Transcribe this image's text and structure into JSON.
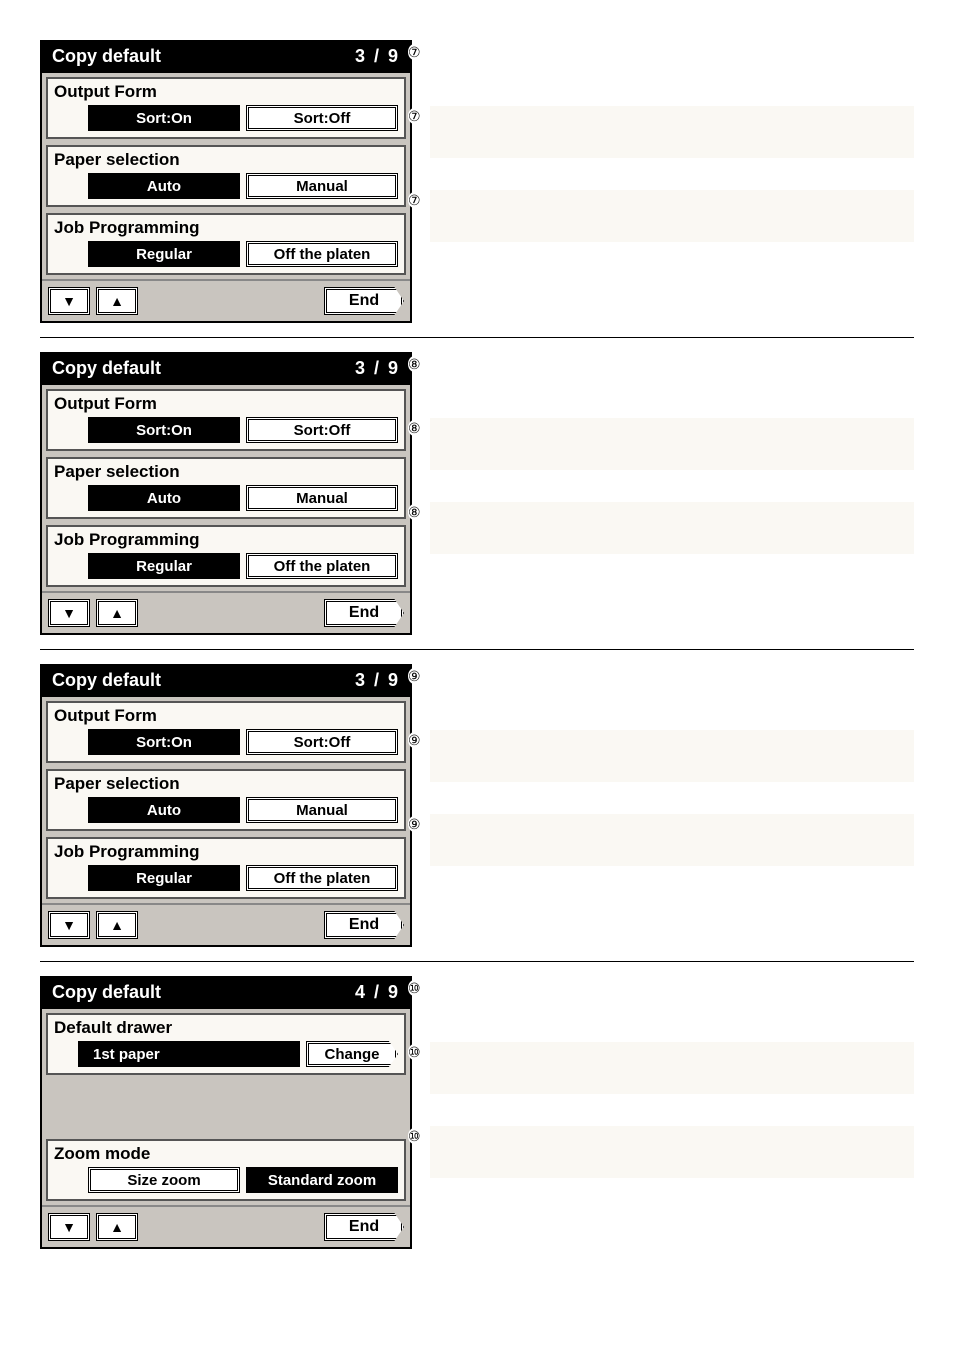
{
  "panels": [
    {
      "title": "Copy default",
      "page": "3 / 9",
      "sections": [
        {
          "label": "Output Form",
          "buttons": [
            {
              "text": "Sort:On",
              "selected": true
            },
            {
              "text": "Sort:Off",
              "selected": false
            }
          ]
        },
        {
          "label": "Paper selection",
          "buttons": [
            {
              "text": "Auto",
              "selected": true
            },
            {
              "text": "Manual",
              "selected": false
            }
          ]
        },
        {
          "label": "Job Programming",
          "buttons": [
            {
              "text": "Regular",
              "selected": true
            },
            {
              "text": "Off the platen",
              "selected": false
            }
          ]
        }
      ],
      "end": "End",
      "numbers": [
        "⑦",
        "⑦",
        "⑦"
      ]
    },
    {
      "title": "Copy default",
      "page": "3 / 9",
      "sections": [
        {
          "label": "Output Form",
          "buttons": [
            {
              "text": "Sort:On",
              "selected": true
            },
            {
              "text": "Sort:Off",
              "selected": false
            }
          ]
        },
        {
          "label": "Paper selection",
          "buttons": [
            {
              "text": "Auto",
              "selected": true
            },
            {
              "text": "Manual",
              "selected": false
            }
          ]
        },
        {
          "label": "Job Programming",
          "buttons": [
            {
              "text": "Regular",
              "selected": true
            },
            {
              "text": "Off the platen",
              "selected": false
            }
          ]
        }
      ],
      "end": "End",
      "numbers": [
        "⑧",
        "⑧",
        "⑧"
      ]
    },
    {
      "title": "Copy default",
      "page": "3 / 9",
      "sections": [
        {
          "label": "Output Form",
          "buttons": [
            {
              "text": "Sort:On",
              "selected": true
            },
            {
              "text": "Sort:Off",
              "selected": false
            }
          ]
        },
        {
          "label": "Paper selection",
          "buttons": [
            {
              "text": "Auto",
              "selected": true
            },
            {
              "text": "Manual",
              "selected": false
            }
          ]
        },
        {
          "label": "Job Programming",
          "buttons": [
            {
              "text": "Regular",
              "selected": true
            },
            {
              "text": "Off the platen",
              "selected": false
            }
          ]
        }
      ],
      "end": "End",
      "numbers": [
        "⑨",
        "⑨",
        "⑨"
      ]
    },
    {
      "title": "Copy default",
      "page": "4 / 9",
      "drawer_label": "Default drawer",
      "drawer_value": "1st paper",
      "change": "Change",
      "zoom_label": "Zoom mode",
      "zoom_buttons": [
        {
          "text": "Size zoom",
          "selected": false
        },
        {
          "text": "Standard zoom",
          "selected": true
        }
      ],
      "end": "End",
      "numbers": [
        "⑩",
        "⑩",
        "⑩"
      ]
    }
  ],
  "nav": {
    "down": "▼",
    "up": "▲"
  }
}
